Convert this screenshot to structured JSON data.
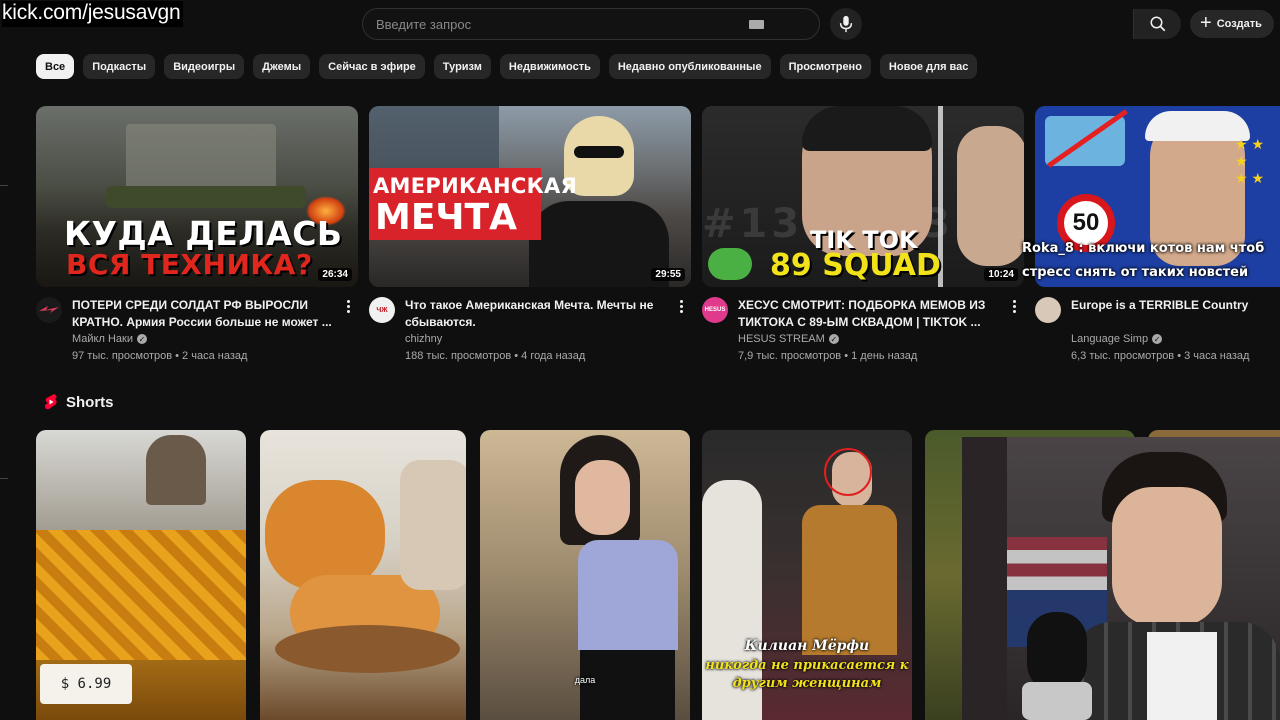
{
  "stream_overlay": {
    "url": "kick.com/jesusavgn"
  },
  "search": {
    "placeholder": "Введите запрос"
  },
  "header": {
    "create_label": "Создать"
  },
  "chips": [
    {
      "label": "Все",
      "active": true
    },
    {
      "label": "Подкасты"
    },
    {
      "label": "Видеоигры"
    },
    {
      "label": "Джемы"
    },
    {
      "label": "Сейчас в эфире"
    },
    {
      "label": "Туризм"
    },
    {
      "label": "Недвижимость"
    },
    {
      "label": "Недавно опубликованные"
    },
    {
      "label": "Просмотрено"
    },
    {
      "label": "Новое для вас"
    }
  ],
  "videos": [
    {
      "title": "ПОТЕРИ СРЕДИ СОЛДАТ РФ ВЫРОСЛИ КРАТНО. Армия России больше не может ...",
      "channel": "Майкл Наки",
      "stats": "97 тыс. просмотров • 2 часа назад",
      "duration": "26:34",
      "thumb_line1": "КУДА ДЕЛАСЬ",
      "thumb_line2": "ВСЯ ТЕХНИКА?"
    },
    {
      "title": "Что такое Американская Мечта. Мечты не сбываются.",
      "channel": "chizhny",
      "stats": "188 тыс. просмотров • 4 года назад",
      "duration": "29:55",
      "thumb_line1": "АМЕРИКАНСКАЯ",
      "thumb_line2": "МЕЧТА"
    },
    {
      "title": "ХЕСУС СМОТРИТ: ПОДБОРКА МЕМОВ ИЗ ТИКТОКА С 89-ЫМ СКВАДОМ | TIKTOK ...",
      "channel": "HESUS STREAM",
      "stats": "7,9 тыс. просмотров • 1 день назад",
      "duration": "10:24",
      "thumb_line1": "TIK TOK",
      "thumb_line2": "89 SQUAD",
      "thumb_bg": "#131 #131"
    },
    {
      "title": "Europe is a TERRIBLE Country",
      "channel": "Language Simp",
      "stats": "6,3 тыс. просмотров • 3 часа назад",
      "thumb_sign": "50"
    }
  ],
  "chat_overlay": {
    "user": "Roka_8",
    "message": " : включи котов нам чтоб стресс снять от таких новстей"
  },
  "shorts": {
    "title": "Shorts",
    "items": [
      {
        "caption": "$ 6.99"
      },
      {
        "caption": ""
      },
      {
        "caption": "дала"
      },
      {
        "caption_line1": "Килиан Мёрфи",
        "caption_line2": "никогда не прикасается к",
        "caption_line3": "другим женщинам"
      },
      {
        "caption": ""
      }
    ]
  },
  "colors": {
    "background": "#0f0f0f",
    "chip": "#272727",
    "chip_active": "#f1f1f1",
    "secondary_text": "#aaaaaa",
    "shorts_red": "#ff0033"
  }
}
